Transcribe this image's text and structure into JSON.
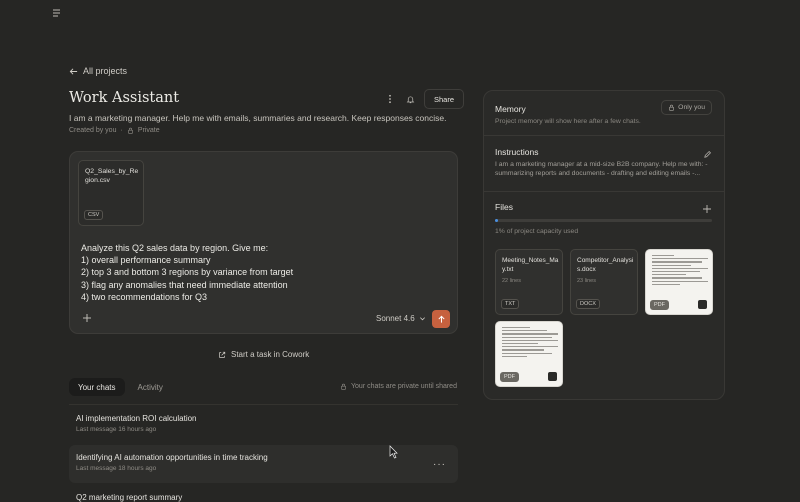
{
  "nav": {
    "back_label": "All projects"
  },
  "project": {
    "title": "Work Assistant",
    "description": "I am a marketing manager. Help me with emails, summaries and research. Keep responses concise.",
    "created_by": "Created by you",
    "visibility": "Private",
    "share_label": "Share"
  },
  "composer": {
    "attachment": {
      "name": "Q2_Sales_by_Region.csv",
      "type": "CSV"
    },
    "prompt_lines": [
      "Analyze this Q2 sales data by region. Give me:",
      "1) overall performance summary",
      "2) top 3 and bottom 3 regions by variance from target",
      "3) flag any anomalies that need immediate attention",
      "4) two recommendations for Q3"
    ],
    "model": "Sonnet 4.6"
  },
  "cowork_label": "Start a task in Cowork",
  "tabs": {
    "chats": "Your chats",
    "activity": "Activity"
  },
  "private_note": "Your chats are private until shared",
  "chats": [
    {
      "title": "AI implementation ROI calculation",
      "subtitle": "Last message 16 hours ago"
    },
    {
      "title": "Identifying AI automation opportunities in time tracking",
      "subtitle": "Last message 18 hours ago"
    },
    {
      "title": "Q2 marketing report summary",
      "subtitle": ""
    }
  ],
  "memory": {
    "title": "Memory",
    "badge": "Only you",
    "subtitle": "Project memory will show here after a few chats."
  },
  "instructions": {
    "title": "Instructions",
    "text_line1": "I am a marketing manager at a mid-size B2B company. Help me with: -",
    "text_line2": "summarizing reports and documents - drafting and editing emails -..."
  },
  "files": {
    "title": "Files",
    "capacity_text": "1% of project capacity used",
    "capacity_fraction": 0.01,
    "items": [
      {
        "name": "Meeting_Notes_May.txt",
        "lines": "22 lines",
        "type": "TXT"
      },
      {
        "name": "Competitor_Analysis.docx",
        "lines": "23 lines",
        "type": "DOCX"
      },
      {
        "type": "PDF"
      },
      {
        "type": "PDF"
      }
    ]
  },
  "colors": {
    "accent": "#c6613f",
    "background": "#262624",
    "progress": "#4a8fe0"
  }
}
